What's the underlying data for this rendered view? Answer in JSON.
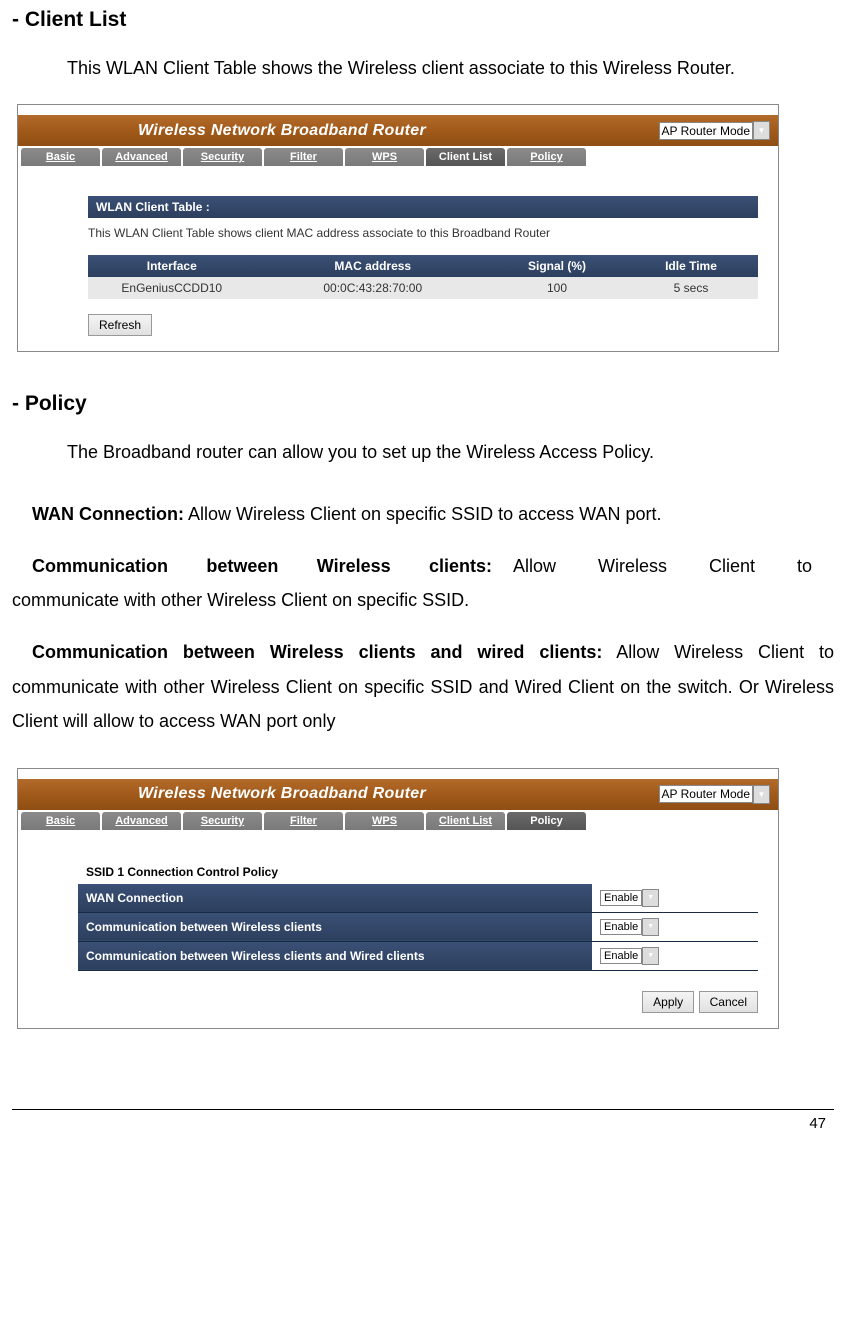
{
  "sections": {
    "client_list": {
      "heading": "- Client List",
      "intro": "This WLAN Client Table shows the Wireless client associate to this Wireless Router."
    },
    "policy": {
      "heading": "- Policy",
      "intro": "The Broadband router can allow you to set up the Wireless Access Policy.",
      "wan_label": "WAN Connection:",
      "wan_text": " Allow Wireless Client on specific SSID to access WAN port.",
      "comm_wl_label": "Communication between Wireless clients:",
      "comm_wl_text": " Allow Wireless Client to communicate with other Wireless Client on specific SSID.",
      "comm_wired_label": "Communication between Wireless clients and wired clients:",
      "comm_wired_text": " Allow Wireless Client to communicate with other Wireless Client on specific SSID and Wired Client on the switch. Or Wireless Client will allow to access WAN port only"
    }
  },
  "router": {
    "title": "Wireless Network Broadband Router",
    "mode": "AP Router Mode",
    "nav": {
      "basic": "Basic",
      "advanced": "Advanced",
      "security": "Security",
      "filter": "Filter",
      "wps": "WPS",
      "client_list": "Client List",
      "policy": "Policy"
    },
    "wlan_table": {
      "bar": "WLAN Client Table :",
      "desc": "This WLAN Client Table shows client MAC address associate to this Broadband Router",
      "cols": {
        "iface": "Interface",
        "mac": "MAC address",
        "signal": "Signal (%)",
        "idle": "Idle Time"
      },
      "row": {
        "iface": "EnGeniusCCDD10",
        "mac": "00:0C:43:28:70:00",
        "signal": "100",
        "idle": "5 secs"
      },
      "refresh": "Refresh"
    },
    "policy_panel": {
      "section_title": "SSID 1 Connection Control Policy",
      "rows": {
        "wan": "WAN Connection",
        "wireless": "Communication between Wireless clients",
        "wired": "Communication between Wireless clients and Wired clients"
      },
      "enable": "Enable",
      "apply": "Apply",
      "cancel": "Cancel"
    }
  },
  "page_number": "47"
}
